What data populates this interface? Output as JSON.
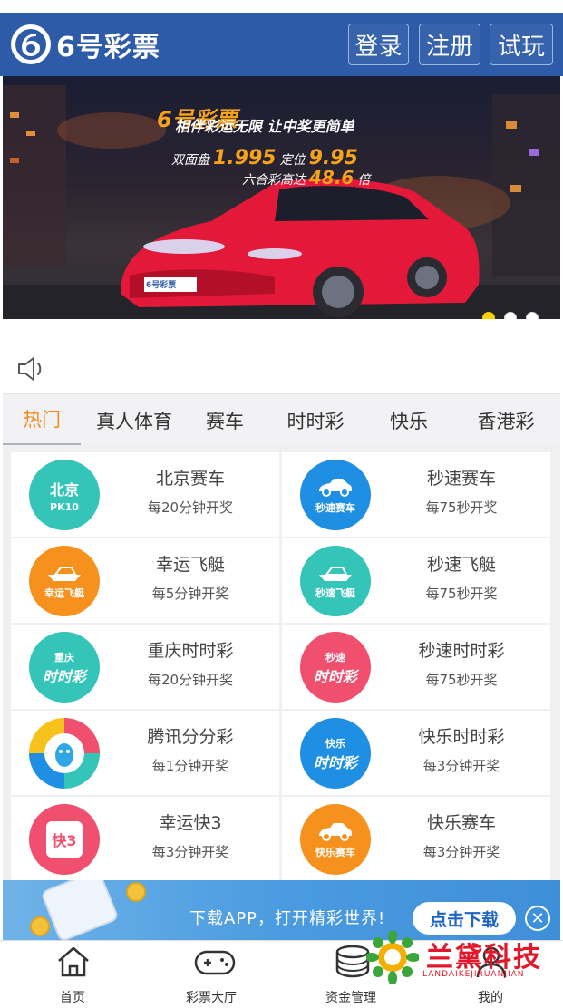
{
  "header": {
    "logo_text": "6号彩票",
    "login_label": "登录",
    "register_label": "注册",
    "trial_label": "试玩",
    "bg_color": "#2d5ba8"
  },
  "banner": {
    "brand": "6号彩票",
    "slogan": "相伴彩运无限 让中奖更简单",
    "line_double": "双面盘",
    "double_value": "1.995",
    "line_position": "定位",
    "position_value": "9.95",
    "line_liuhe": "六合彩高达",
    "liuhe_value": "48.6",
    "liuhe_unit": "倍",
    "plate": "6号彩票",
    "slides": 3,
    "active_slide": 1
  },
  "tabs": [
    {
      "label": "热门",
      "active": true
    },
    {
      "label": "真人体育"
    },
    {
      "label": "赛车"
    },
    {
      "label": "时时彩"
    },
    {
      "label": "快乐"
    },
    {
      "label": "香港彩"
    }
  ],
  "games": [
    {
      "name": "北京赛车",
      "desc": "每20分钟开奖",
      "icon": "beijing-pk10-icon",
      "icon_top": "北京",
      "icon_bottom": "PK10",
      "color": "#35c5b8"
    },
    {
      "name": "秒速赛车",
      "desc": "每75秒开奖",
      "icon": "race-car-icon",
      "icon_top": "",
      "icon_bottom": "秒速赛车",
      "color": "#1e8fe2"
    },
    {
      "name": "幸运飞艇",
      "desc": "每5分钟开奖",
      "icon": "speedboat-icon",
      "icon_top": "",
      "icon_bottom": "幸运飞艇",
      "color": "#f7911d"
    },
    {
      "name": "秒速飞艇",
      "desc": "每75秒开奖",
      "icon": "speedboat-icon",
      "icon_top": "",
      "icon_bottom": "秒速飞艇",
      "color": "#35c5b8"
    },
    {
      "name": "重庆时时彩",
      "desc": "每20分钟开奖",
      "icon": "ssc-lottery-icon",
      "icon_top": "重庆",
      "icon_bottom": "时时彩",
      "color": "#35c5b8"
    },
    {
      "name": "秒速时时彩",
      "desc": "每75秒开奖",
      "icon": "ssc-lottery-icon",
      "icon_top": "秒速",
      "icon_bottom": "时时彩",
      "color": "#f0506e"
    },
    {
      "name": "腾讯分分彩",
      "desc": "每1分钟开奖",
      "icon": "qq-penguin-icon",
      "icon_top": "",
      "icon_bottom": "",
      "color": "#2fa7e6"
    },
    {
      "name": "快乐时时彩",
      "desc": "每3分钟开奖",
      "icon": "ssc-lottery-icon",
      "icon_top": "快乐",
      "icon_bottom": "时时彩",
      "color": "#1e8fe2"
    },
    {
      "name": "幸运快3",
      "desc": "每3分钟开奖",
      "icon": "dice-k3-icon",
      "icon_top": "快3",
      "icon_bottom": "",
      "color": "#f0506e"
    },
    {
      "name": "快乐赛车",
      "desc": "每3分钟开奖",
      "icon": "race-car-icon",
      "icon_top": "",
      "icon_bottom": "快乐赛车",
      "color": "#f7911d"
    }
  ],
  "download": {
    "text": "下载APP，打开精彩世界!",
    "button_label": "点击下载",
    "close_icon": "close-icon"
  },
  "bottom_nav": [
    {
      "label": "首页",
      "icon": "home-icon"
    },
    {
      "label": "彩票大厅",
      "icon": "gamepad-icon"
    },
    {
      "label": "资金管理",
      "icon": "coins-icon"
    },
    {
      "label": "我的",
      "icon": "user-icon"
    }
  ],
  "watermark": {
    "text": "兰黛科技",
    "sub": "LANDAIKEJIRUANJIAN"
  }
}
